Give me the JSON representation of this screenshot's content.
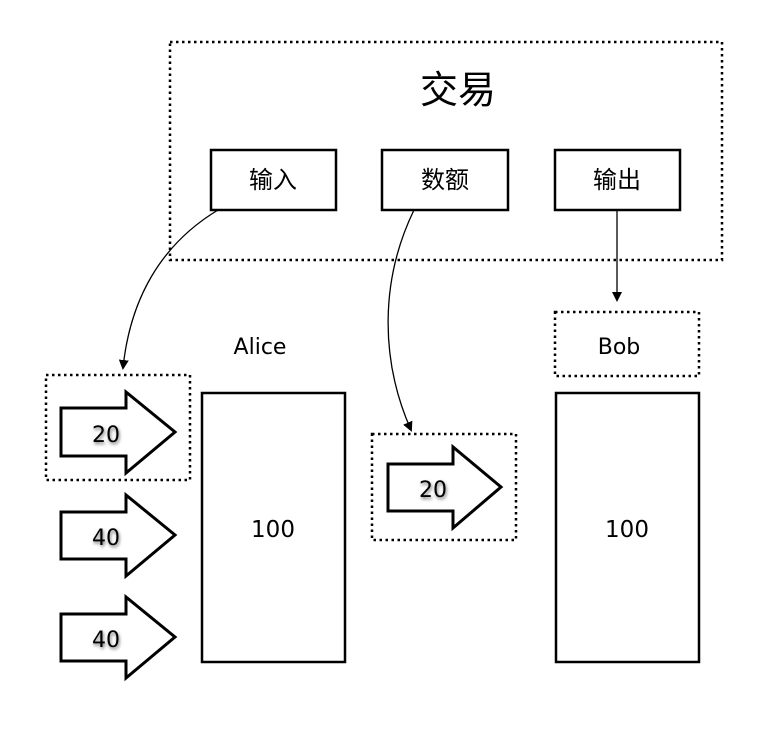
{
  "transaction": {
    "title": "交易",
    "fields": {
      "input": "输入",
      "amount": "数额",
      "output": "输出"
    }
  },
  "alice": {
    "name": "Alice",
    "balance": "100",
    "coins": [
      "20",
      "40",
      "40"
    ]
  },
  "amount_coin": "20",
  "bob": {
    "name": "Bob",
    "balance": "100"
  }
}
